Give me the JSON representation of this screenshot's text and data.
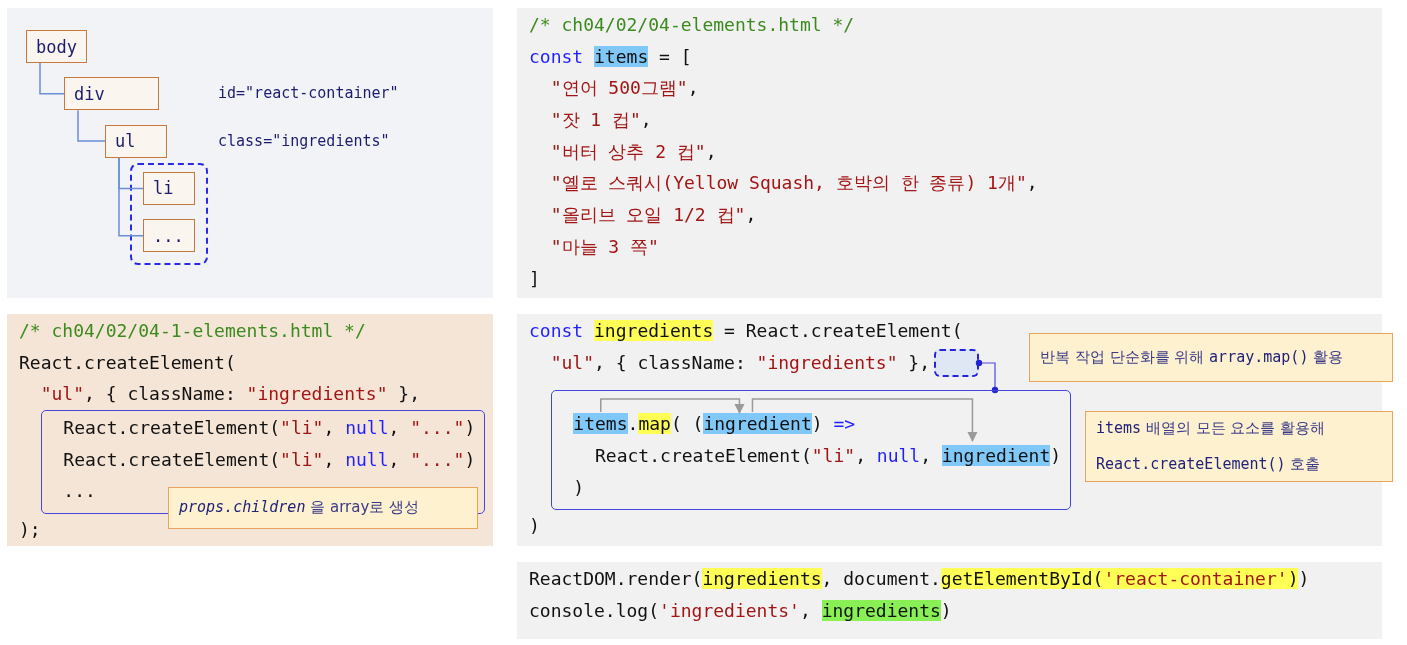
{
  "tree": {
    "nodes": [
      {
        "label": "body",
        "children": [
          {
            "label": "div",
            "note": "id=\"react-container\"",
            "children": [
              {
                "label": "ul",
                "note": "class=\"ingredients\"",
                "grouped": true,
                "children": [
                  {
                    "label": "li"
                  },
                  {
                    "label": "..."
                  }
                ]
              }
            ]
          }
        ]
      }
    ]
  },
  "items_code": {
    "lines": [
      {
        "tokens": [
          {
            "text": "/* ch04/02/04-elements.html */",
            "kind": "comment"
          }
        ]
      },
      {
        "tokens": [
          {
            "text": "const ",
            "kind": "keyword"
          },
          {
            "text": "items",
            "kind": "plain",
            "color": "#80c8f8"
          },
          {
            "text": " = [",
            "kind": "plain"
          }
        ]
      },
      {
        "tokens": [
          {
            "text": "  \"연어 500그램\"",
            "kind": "string"
          },
          {
            "text": ",",
            "kind": "plain"
          }
        ]
      },
      {
        "tokens": [
          {
            "text": "  \"잣 1 컵\"",
            "kind": "string"
          },
          {
            "text": ",",
            "kind": "plain"
          }
        ]
      },
      {
        "tokens": [
          {
            "text": "  \"버터 상추 2 컵\"",
            "kind": "string"
          },
          {
            "text": ",",
            "kind": "plain"
          }
        ]
      },
      {
        "tokens": [
          {
            "text": "  \"옐로 스쿼시(Yellow Squash, 호박의 한 종류) 1개\"",
            "kind": "string"
          },
          {
            "text": ",",
            "kind": "plain"
          }
        ]
      },
      {
        "tokens": [
          {
            "text": "  \"올리브 오일 1/2 컵\"",
            "kind": "string"
          },
          {
            "text": ",",
            "kind": "plain"
          }
        ]
      },
      {
        "tokens": [
          {
            "text": "  \"마늘 3 쪽\"",
            "kind": "string"
          }
        ]
      },
      {
        "tokens": [
          {
            "text": "]",
            "kind": "plain"
          }
        ]
      }
    ]
  },
  "manual_code": {
    "lines": [
      {
        "tokens": [
          {
            "text": "/* ch04/02/04-1-elements.html */",
            "kind": "comment"
          }
        ]
      },
      {
        "tokens": [
          {
            "text": "React.createElement(",
            "kind": "plain"
          }
        ]
      },
      {
        "tokens": [
          {
            "text": "  \"ul\"",
            "kind": "string"
          },
          {
            "text": ", { className: ",
            "kind": "plain"
          },
          {
            "text": "\"ingredients\"",
            "kind": "string"
          },
          {
            "text": " },",
            "kind": "plain"
          }
        ]
      },
      {
        "kind": "group",
        "lines": [
          {
            "tokens": [
              {
                "text": "React.createElement(",
                "kind": "plain"
              },
              {
                "text": "\"li\"",
                "kind": "string"
              },
              {
                "text": ", ",
                "kind": "plain"
              },
              {
                "text": "null",
                "kind": "keyword"
              },
              {
                "text": ", ",
                "kind": "plain"
              },
              {
                "text": "\"...\"",
                "kind": "string"
              },
              {
                "text": ")",
                "kind": "plain"
              }
            ]
          },
          {
            "tokens": [
              {
                "text": "React.createElement(",
                "kind": "plain"
              },
              {
                "text": "\"li\"",
                "kind": "string"
              },
              {
                "text": ", ",
                "kind": "plain"
              },
              {
                "text": "null",
                "kind": "keyword"
              },
              {
                "text": ", ",
                "kind": "plain"
              },
              {
                "text": "\"...\"",
                "kind": "string"
              },
              {
                "text": ")",
                "kind": "plain"
              }
            ]
          },
          {
            "tokens": [
              {
                "text": "...",
                "kind": "plain"
              }
            ]
          }
        ]
      },
      {
        "tokens": [
          {
            "text": ");",
            "kind": "plain"
          }
        ]
      }
    ],
    "callout": [
      "*props.children* 을 array로 생성"
    ]
  },
  "map_code": {
    "lines": [
      {
        "tokens": [
          {
            "text": "const ",
            "kind": "keyword"
          },
          {
            "text": "ingredients",
            "kind": "plain",
            "color": "#ffff55"
          },
          {
            "text": " = React.createElement(",
            "kind": "plain"
          }
        ]
      },
      {
        "slot": true,
        "tokens": [
          {
            "text": "  \"ul\"",
            "kind": "string"
          },
          {
            "text": ", { className: ",
            "kind": "plain"
          },
          {
            "text": "\"ingredients\"",
            "kind": "string"
          },
          {
            "text": " },",
            "kind": "plain"
          }
        ]
      },
      {
        "kind": "group",
        "lines": [
          {
            "tokens": [
              {
                "text": "items",
                "kind": "plain",
                "color": "#80c8f8"
              },
              {
                "text": ".",
                "kind": "plain"
              },
              {
                "text": "map",
                "kind": "plain",
                "color": "#ffff55"
              },
              {
                "text": "( (",
                "kind": "plain"
              },
              {
                "text": "ingredient",
                "kind": "plain",
                "color": "#80c8f8"
              },
              {
                "text": ") ",
                "kind": "plain"
              },
              {
                "text": "=>",
                "kind": "keyword"
              }
            ]
          },
          {
            "tokens": [
              {
                "text": "  React.createElement(",
                "kind": "plain"
              },
              {
                "text": "\"li\"",
                "kind": "string"
              },
              {
                "text": ", ",
                "kind": "plain"
              },
              {
                "text": "null",
                "kind": "keyword"
              },
              {
                "text": ", ",
                "kind": "plain"
              },
              {
                "text": "ingredient",
                "kind": "plain",
                "color": "#80c8f8"
              },
              {
                "text": ")",
                "kind": "plain"
              }
            ]
          },
          {
            "tokens": [
              {
                "text": ")",
                "kind": "plain"
              }
            ]
          }
        ]
      },
      {
        "tokens": [
          {
            "text": ")",
            "kind": "plain"
          }
        ]
      }
    ],
    "callouts": [
      [
        "반복 작업 단순화를 위해 **array.map()** 활용"
      ],
      [
        "**items** 배열의 모든 요소를 활용해",
        "**React.createElement()** 호출"
      ]
    ]
  },
  "render_code": {
    "lines": [
      {
        "tokens": [
          {
            "text": "ReactDOM.render(",
            "kind": "plain"
          },
          {
            "text": "ingredients",
            "kind": "plain",
            "color": "#ffff55"
          },
          {
            "text": ", document.",
            "kind": "plain"
          },
          {
            "text": "getElementById(",
            "kind": "plain",
            "color": "#ffff55"
          },
          {
            "text": "'react-container'",
            "kind": "string",
            "color": "#ffff55"
          },
          {
            "text": ")",
            "kind": "plain",
            "color": "#ffff55"
          },
          {
            "text": ")",
            "kind": "plain"
          }
        ]
      },
      {
        "tokens": [
          {
            "text": "console.log(",
            "kind": "plain"
          },
          {
            "text": "'ingredients'",
            "kind": "string"
          },
          {
            "text": ", ",
            "kind": "plain"
          },
          {
            "text": "ingredients",
            "kind": "plain",
            "color": "#88f055"
          },
          {
            "text": ")",
            "kind": "plain"
          }
        ]
      }
    ]
  }
}
